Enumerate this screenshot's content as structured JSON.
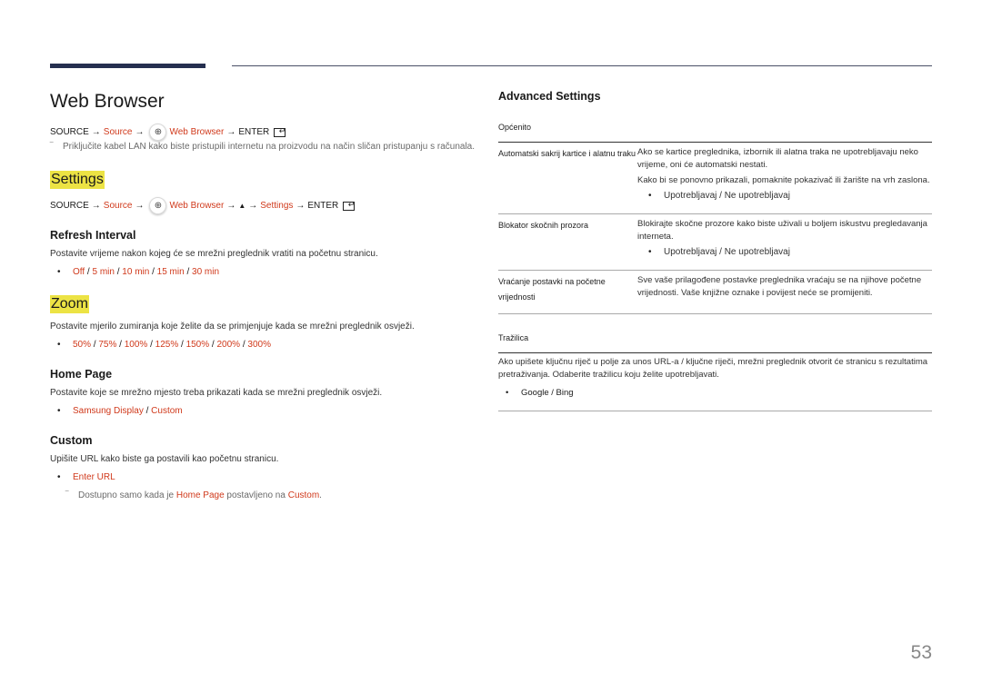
{
  "page_title": "Web Browser",
  "top_path": {
    "source": "SOURCE",
    "source_menu": "Source",
    "app": "Web Browser",
    "enter": "ENTER"
  },
  "top_note": "Priključite kabel LAN kako biste pristupili internetu na proizvodu na način sličan pristupanju s računala.",
  "settings": {
    "title": "Settings",
    "path": {
      "source": "SOURCE",
      "source_menu": "Source",
      "app": "Web Browser",
      "settings": "Settings",
      "enter": "ENTER"
    },
    "refresh_interval": {
      "title": "Refresh Interval",
      "desc": "Postavite vrijeme nakon kojeg će se mrežni preglednik vratiti na početnu stranicu.",
      "options": [
        "Off",
        "5 min",
        "10 min",
        "15 min",
        "30 min"
      ]
    }
  },
  "zoom": {
    "title": "Zoom",
    "desc": "Postavite mjerilo zumiranja koje želite da se primjenjuje kada se mrežni preglednik osvježi.",
    "options": [
      "50%",
      "75%",
      "100%",
      "125%",
      "150%",
      "200%",
      "300%"
    ]
  },
  "home_page": {
    "title": "Home Page",
    "desc": "Postavite koje se mrežno mjesto treba prikazati kada se mrežni preglednik osvježi.",
    "options": [
      "Samsung Display",
      "Custom"
    ]
  },
  "custom": {
    "title": "Custom",
    "desc": "Upišite URL kako biste ga postavili kao početnu stranicu.",
    "option": "Enter URL",
    "note_prefix": "Dostupno samo kada je ",
    "note_link1": "Home Page",
    "note_middle": " postavljeno na ",
    "note_link2": "Custom",
    "note_suffix": "."
  },
  "advanced": {
    "title": "Advanced Settings",
    "general_label": "Općenito",
    "rows": [
      {
        "name": "Automatski sakrij kartice i alatnu traku",
        "paras": [
          "Ako se kartice preglednika, izbornik ili alatna traka ne upotrebljavaju neko vrijeme, oni će automatski nestati.",
          "Kako bi se ponovno prikazali, pomaknite pokazivač ili žarište na vrh zaslona."
        ],
        "option": "Upotrebljavaj / Ne upotrebljavaj"
      },
      {
        "name": "Blokator skočnih prozora",
        "paras": [
          "Blokirajte skočne prozore kako biste uživali u boljem iskustvu pregledavanja interneta."
        ],
        "option": "Upotrebljavaj / Ne upotrebljavaj"
      },
      {
        "name": "Vraćanje postavki na početne vrijednosti",
        "paras": [
          "Sve vaše prilagođene postavke preglednika vraćaju se na njihove početne vrijednosti. Vaše knjižne oznake i povijest neće se promijeniti."
        ]
      }
    ],
    "search_label": "Tražilica",
    "search_desc": "Ako upišete ključnu riječ u polje za unos URL-a / ključne riječi, mrežni preglednik otvorit će stranicu s rezultatima pretraživanja. Odaberite tražilicu koju želite upotrebljavati.",
    "search_option": "Google / Bing"
  },
  "page_number": "53",
  "icons": {
    "arrow": "→",
    "up": "▲",
    "globe": "⊕"
  },
  "colors": {
    "accent": "#d0391b",
    "highlight": "#ece344",
    "header_bar": "#252f4f"
  }
}
